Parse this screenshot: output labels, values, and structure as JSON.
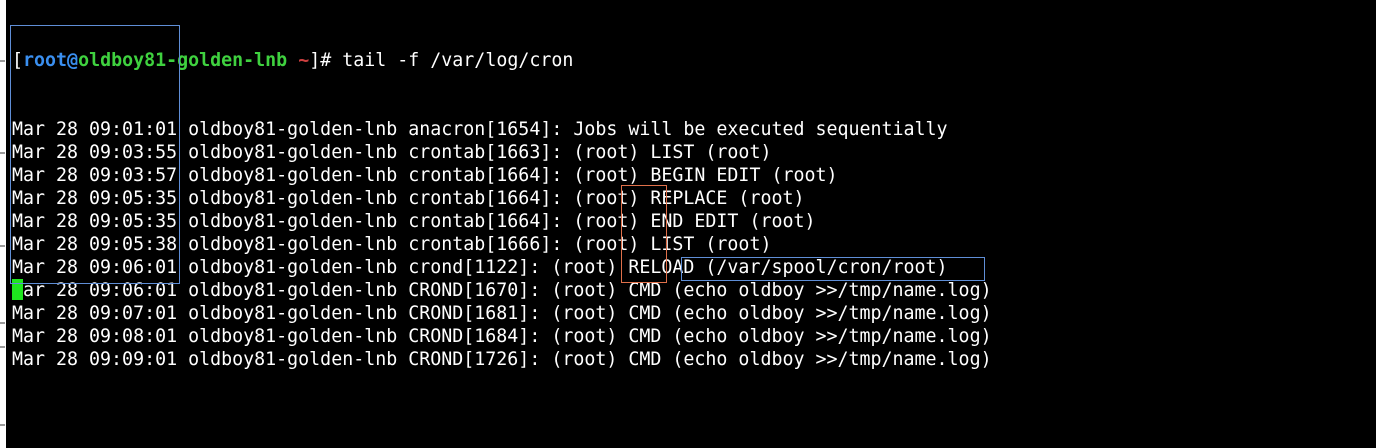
{
  "prompt": {
    "open_bracket": "[",
    "user": "root",
    "at": "@",
    "host": "oldboy81-golden-lnb",
    "cwd": " ~",
    "close": "]# ",
    "command": "tail -f /var/log/cron"
  },
  "log_lines": [
    {
      "ts": "Mar 28 09:01:01",
      "host": "oldboy81-golden-lnb",
      "msg": "anacron[1654]: Jobs will be executed sequentially"
    },
    {
      "ts": "Mar 28 09:03:55",
      "host": "oldboy81-golden-lnb",
      "msg": "crontab[1663]: (root) LIST (root)"
    },
    {
      "ts": "Mar 28 09:03:57",
      "host": "oldboy81-golden-lnb",
      "msg": "crontab[1664]: (root) BEGIN EDIT (root)"
    },
    {
      "ts": "Mar 28 09:05:35",
      "host": "oldboy81-golden-lnb",
      "msg": "crontab[1664]: (root) REPLACE (root)"
    },
    {
      "ts": "Mar 28 09:05:35",
      "host": "oldboy81-golden-lnb",
      "msg": "crontab[1664]: (root) END EDIT (root)"
    },
    {
      "ts": "Mar 28 09:05:38",
      "host": "oldboy81-golden-lnb",
      "msg": "crontab[1666]: (root) LIST (root)"
    },
    {
      "ts": "Mar 28 09:06:01",
      "host": "oldboy81-golden-lnb",
      "msg": "crond[1122]: (root) RELOAD (/var/spool/cron/root)"
    },
    {
      "ts": "Mar 28 09:06:01",
      "host": "oldboy81-golden-lnb",
      "msg": "CROND[1670]: (root) CMD (echo oldboy >>/tmp/name.log)"
    },
    {
      "ts": "Mar 28 09:07:01",
      "host": "oldboy81-golden-lnb",
      "msg": "CROND[1681]: (root) CMD (echo oldboy >>/tmp/name.log)"
    },
    {
      "ts": "Mar 28 09:08:01",
      "host": "oldboy81-golden-lnb",
      "msg": "CROND[1684]: (root) CMD (echo oldboy >>/tmp/name.log)"
    },
    {
      "ts": "Mar 28 09:09:01",
      "host": "oldboy81-golden-lnb",
      "msg": "CROND[1726]: (root) CMD (echo oldboy >>/tmp/name.log)"
    }
  ],
  "colors": {
    "background": "#000000",
    "text": "#ffffff",
    "user": "#3a8ff0",
    "host": "#3fd13f",
    "cwd": "#cc3f3f",
    "cursor": "#1ee61e",
    "highlight_blue": "#5f8ed6",
    "highlight_orange": "#e0704a"
  }
}
